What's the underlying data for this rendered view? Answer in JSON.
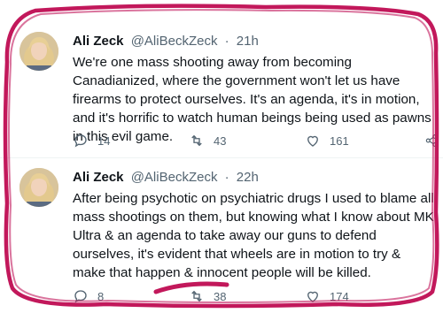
{
  "tweets": [
    {
      "name": "Ali Zeck",
      "handle": "@AliBeckZeck",
      "separator": "·",
      "time": "21h",
      "text": "We're one mass shooting away from becoming Canadianized, where the government won't let us have firearms to protect ourselves. It's an agenda, it's in motion, and it's horrific to watch human beings being used as pawns in this evil game.",
      "replies": "14",
      "retweets": "43",
      "likes": "161"
    },
    {
      "name": "Ali Zeck",
      "handle": "@AliBeckZeck",
      "separator": "·",
      "time": "22h",
      "text": "After being psychotic on psychiatric drugs I used to blame all mass shootings on them, but knowing what I know about MK Ultra & an agenda to take away our guns to defend ourselves, it's evident that wheels are in motion to try & make that happen & innocent people will be killed.",
      "replies": "8",
      "retweets": "38",
      "likes": "174"
    }
  ],
  "colors": {
    "scribble": "#c2185b",
    "muted": "#536471",
    "text": "#0f1419"
  },
  "icons": [
    "reply-icon",
    "retweet-icon",
    "like-icon",
    "share-icon"
  ]
}
